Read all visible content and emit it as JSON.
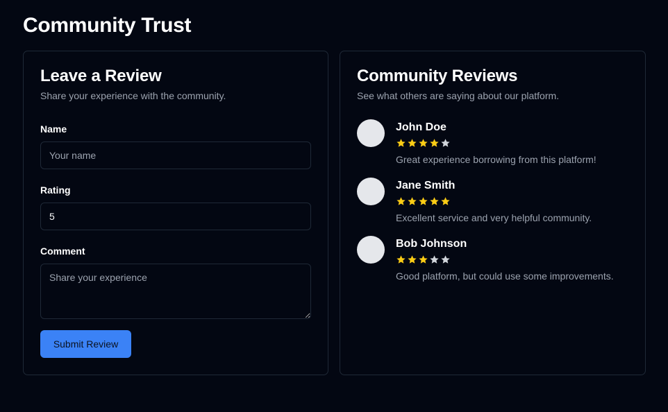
{
  "page": {
    "title": "Community Trust"
  },
  "form": {
    "title": "Leave a Review",
    "subtitle": "Share your experience with the community.",
    "name_label": "Name",
    "name_placeholder": "Your name",
    "name_value": "",
    "rating_label": "Rating",
    "rating_value": "5",
    "comment_label": "Comment",
    "comment_placeholder": "Share your experience",
    "submit_label": "Submit Review"
  },
  "reviews": {
    "title": "Community Reviews",
    "subtitle": "See what others are saying about our platform.",
    "items": [
      {
        "name": "John Doe",
        "rating": 4,
        "max_rating": 5,
        "comment": "Great experience borrowing from this platform!"
      },
      {
        "name": "Jane Smith",
        "rating": 5,
        "max_rating": 5,
        "comment": "Excellent service and very helpful community."
      },
      {
        "name": "Bob Johnson",
        "rating": 3,
        "max_rating": 5,
        "comment": "Good platform, but could use some improvements."
      }
    ]
  },
  "colors": {
    "background": "#030712",
    "border": "#1f2937",
    "accent": "#3b82f6",
    "star_filled": "#facc15",
    "star_empty": "#d1d5db",
    "muted_text": "#9ca3af"
  }
}
